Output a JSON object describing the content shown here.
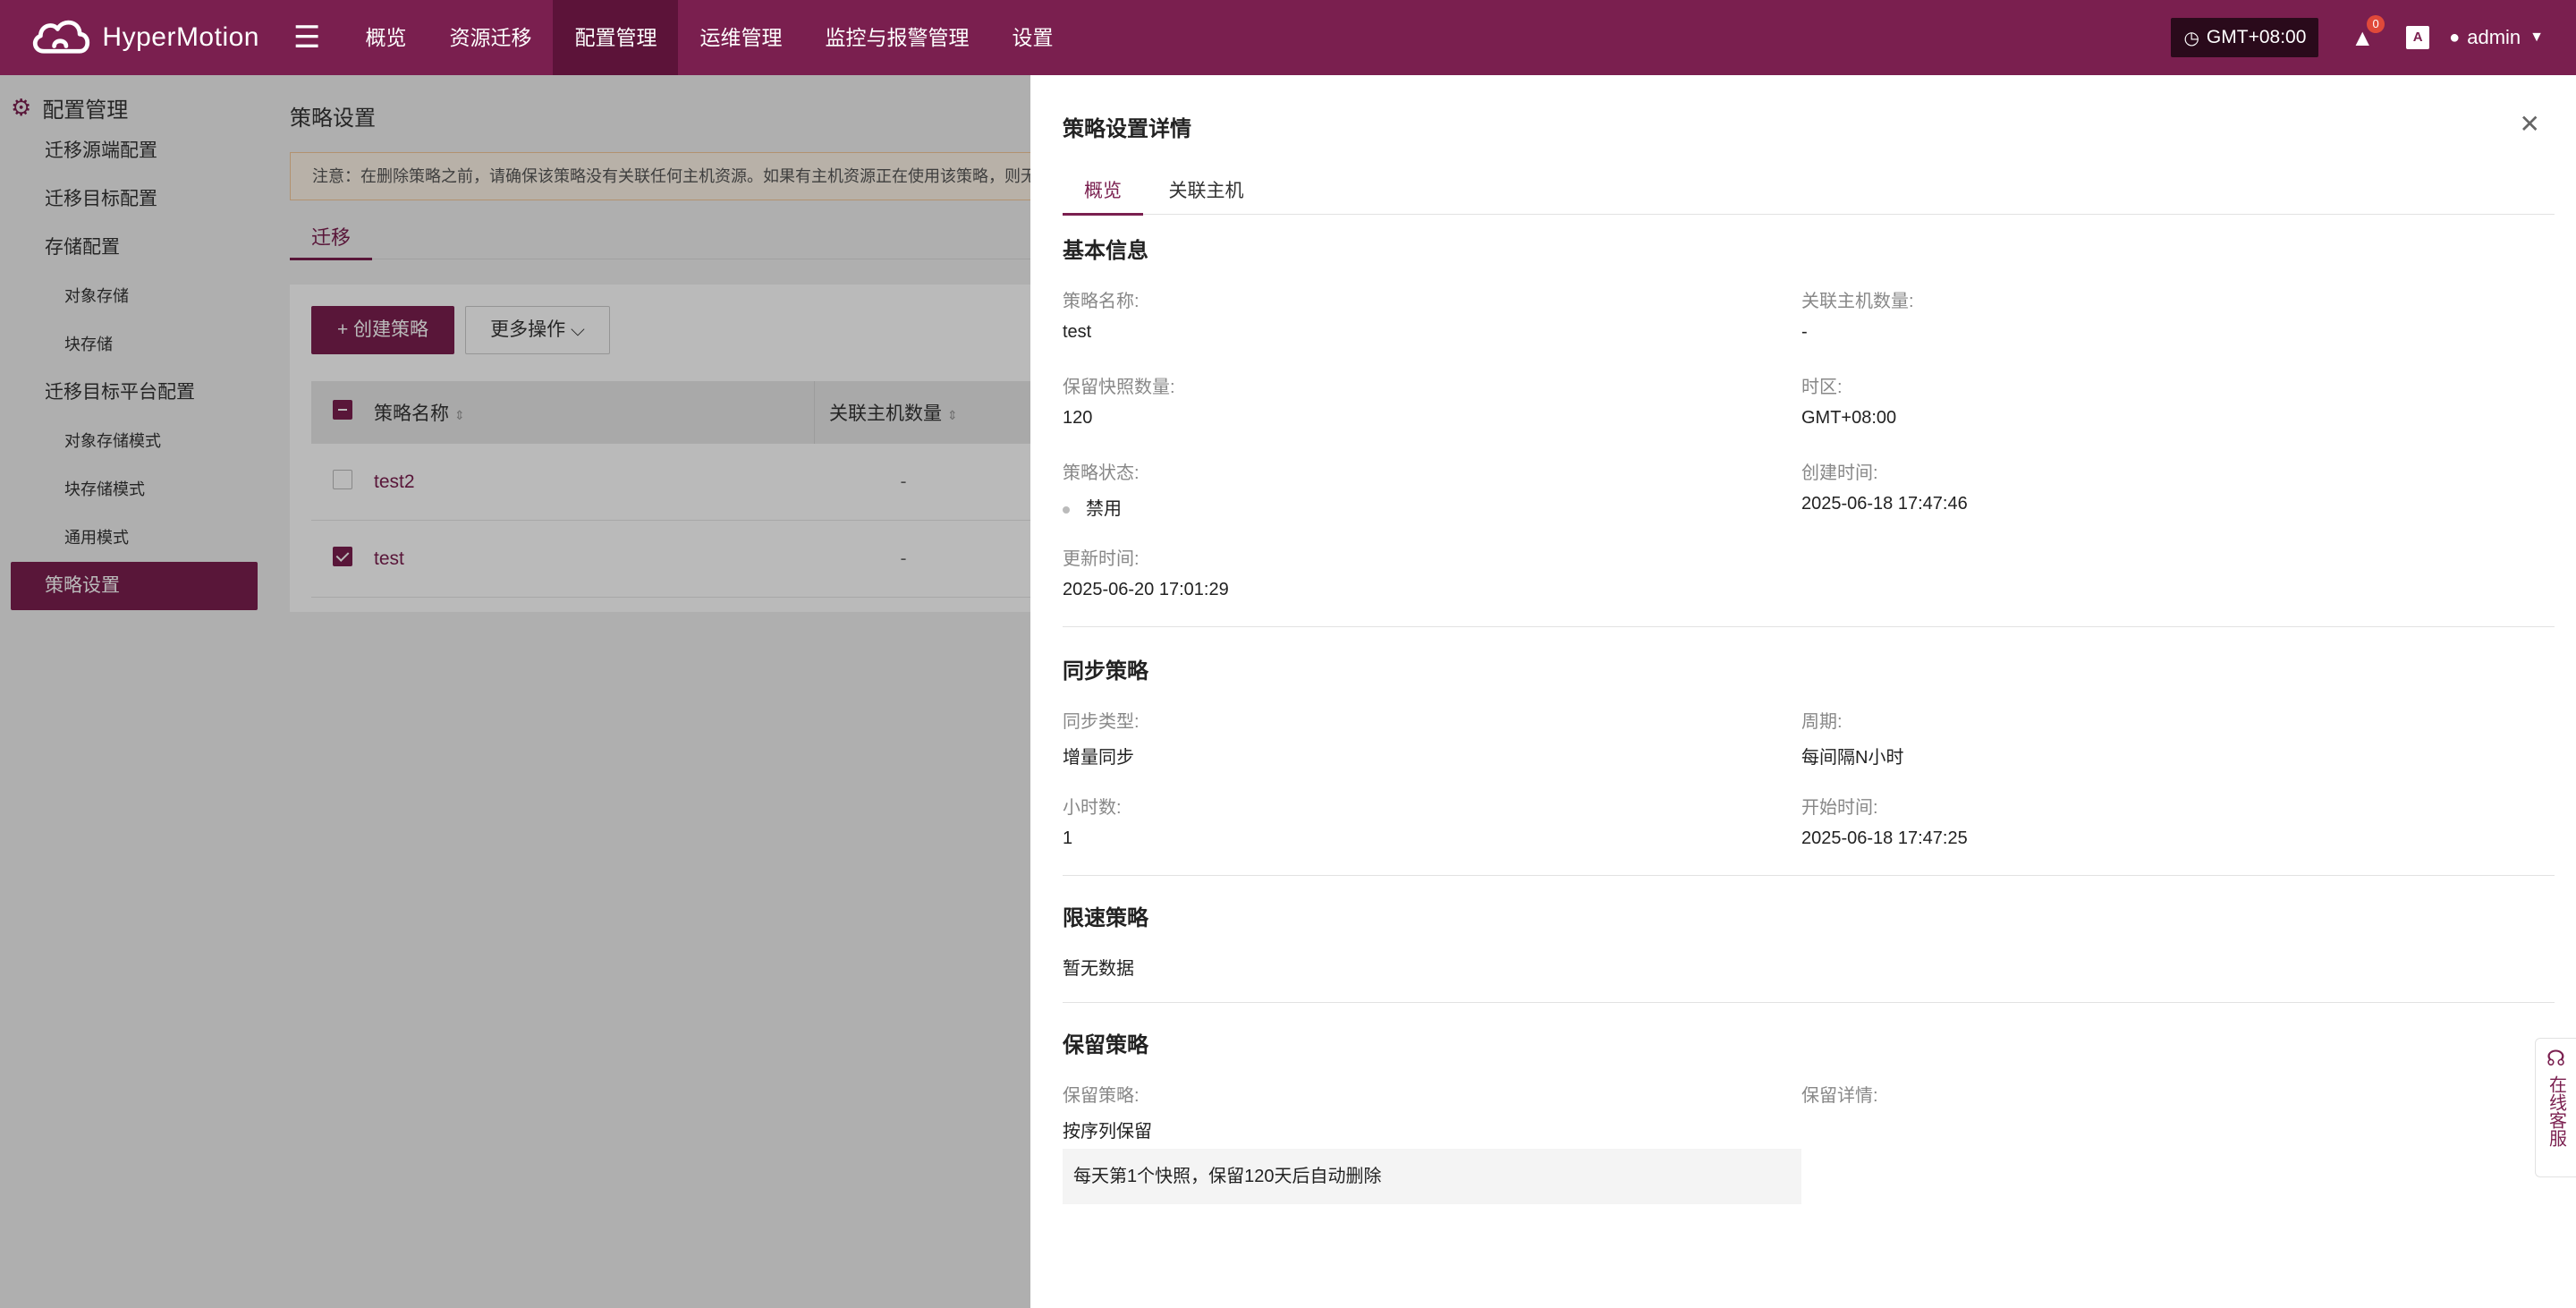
{
  "header": {
    "brand": "HyperMotion",
    "nav": [
      "概览",
      "资源迁移",
      "配置管理",
      "运维管理",
      "监控与报警管理",
      "设置"
    ],
    "timezone": "GMT+08:00",
    "alert_count": "0",
    "lang_icon": "A",
    "user": "admin"
  },
  "sidebar": {
    "title": "配置管理",
    "items": [
      {
        "label": "迁移源端配置"
      },
      {
        "label": "迁移目标配置"
      },
      {
        "label": "存储配置"
      },
      {
        "label": "对象存储"
      },
      {
        "label": "块存储"
      },
      {
        "label": "迁移目标平台配置"
      },
      {
        "label": "对象存储模式"
      },
      {
        "label": "块存储模式"
      },
      {
        "label": "通用模式"
      },
      {
        "label": "策略设置"
      }
    ]
  },
  "main": {
    "title": "策略设置",
    "notice": "注意：在删除策略之前，请确保该策略没有关联任何主机资源。如果有主机资源正在使用该策略，则无",
    "tab": "迁移",
    "create_button": "+ 创建策略",
    "more_button": "更多操作",
    "columns": [
      "策略名称",
      "关联主机数量"
    ],
    "rows": [
      {
        "name": "test2",
        "count": "-"
      },
      {
        "name": "test",
        "count": "-"
      }
    ]
  },
  "drawer": {
    "title": "策略设置详情",
    "tabs": [
      "概览",
      "关联主机"
    ],
    "basic": {
      "title": "基本信息",
      "name_label": "策略名称:",
      "name": "test",
      "hosts_label": "关联主机数量:",
      "hosts": "-",
      "snap_label": "保留快照数量:",
      "snap": "120",
      "tz_label": "时区:",
      "tz": "GMT+08:00",
      "status_label": "策略状态:",
      "status": "禁用",
      "created_label": "创建时间:",
      "created": "2025-06-18 17:47:46",
      "updated_label": "更新时间:",
      "updated": "2025-06-20 17:01:29"
    },
    "sync": {
      "title": "同步策略",
      "type_label": "同步类型:",
      "type": "增量同步",
      "period_label": "周期:",
      "period": "每间隔N小时",
      "hours_label": "小时数:",
      "hours": "1",
      "start_label": "开始时间:",
      "start": "2025-06-18 17:47:25"
    },
    "limit": {
      "title": "限速策略",
      "empty": "暂无数据"
    },
    "retain": {
      "title": "保留策略",
      "policy_label": "保留策略:",
      "policy": "按序列保留",
      "detail_label": "保留详情:",
      "rule": "每天第1个快照，保留120天后自动删除"
    }
  },
  "support": {
    "label": "在线客服"
  },
  "colors": {
    "brand": "#7a1f4f",
    "brand_dark": "#5c1339"
  }
}
